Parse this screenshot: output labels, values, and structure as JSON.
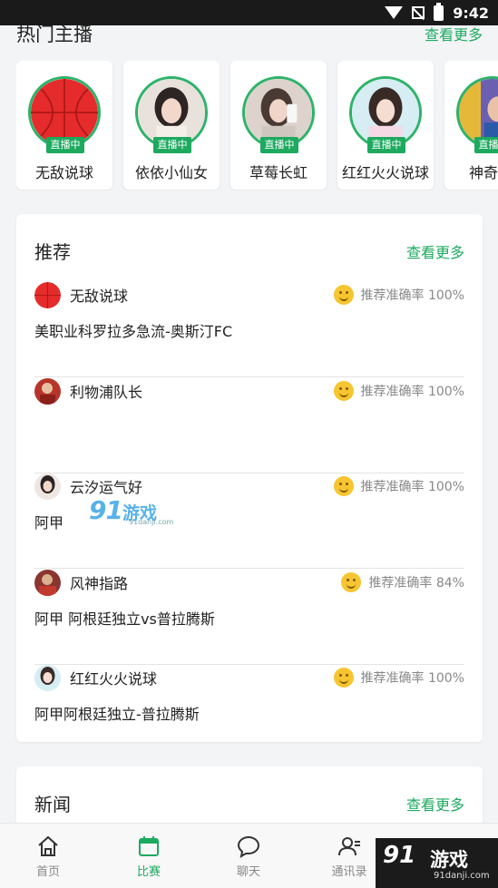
{
  "status_bar": {
    "time": "9:42"
  },
  "hot_anchors": {
    "title": "热门主播",
    "more": "查看更多",
    "live_label": "直播中",
    "items": [
      {
        "name": "无敌说球",
        "avatar_color": "#e52b2b"
      },
      {
        "name": "依依小仙女",
        "avatar_color": "#d9c2b8"
      },
      {
        "name": "草莓长虹",
        "avatar_color": "#c9b3a5"
      },
      {
        "name": "红红火火说球",
        "avatar_color": "#e8c8d4"
      },
      {
        "name": "神奇Sa",
        "avatar_color": "#6a5fb0"
      }
    ]
  },
  "recommend": {
    "title": "推荐",
    "more": "查看更多",
    "items": [
      {
        "name": "无敌说球",
        "accuracy": "推荐准确率 100%",
        "desc": "美职业科罗拉多急流-奥斯汀FC",
        "avatar_color": "#e52b2b"
      },
      {
        "name": "利物浦队长",
        "accuracy": "推荐准确率 100%",
        "desc": "",
        "avatar_color": "#b8342a"
      },
      {
        "name": "云汐运气好",
        "accuracy": "推荐准确率 100%",
        "desc": "阿甲",
        "avatar_color": "#3a3030"
      },
      {
        "name": "风神指路",
        "accuracy": "推荐准确率 84%",
        "desc": "阿甲 阿根廷独立vs普拉腾斯",
        "avatar_color": "#8a3530"
      },
      {
        "name": "红红火火说球",
        "accuracy": "推荐准确率 100%",
        "desc": "阿甲阿根廷独立-普拉腾斯",
        "avatar_color": "#d8b8c8"
      }
    ]
  },
  "news": {
    "title": "新闻",
    "more": "查看更多"
  },
  "watermark": {
    "logo": "91",
    "text": "游戏",
    "url": "91danji.com"
  },
  "tabbar": {
    "active_color": "#1daa5f",
    "tabs": [
      {
        "label": "首页",
        "icon": "home-icon"
      },
      {
        "label": "比赛",
        "icon": "calendar-icon"
      },
      {
        "label": "聊天",
        "icon": "chat-bubble-icon"
      },
      {
        "label": "通讯录",
        "icon": "contacts-icon"
      }
    ]
  }
}
